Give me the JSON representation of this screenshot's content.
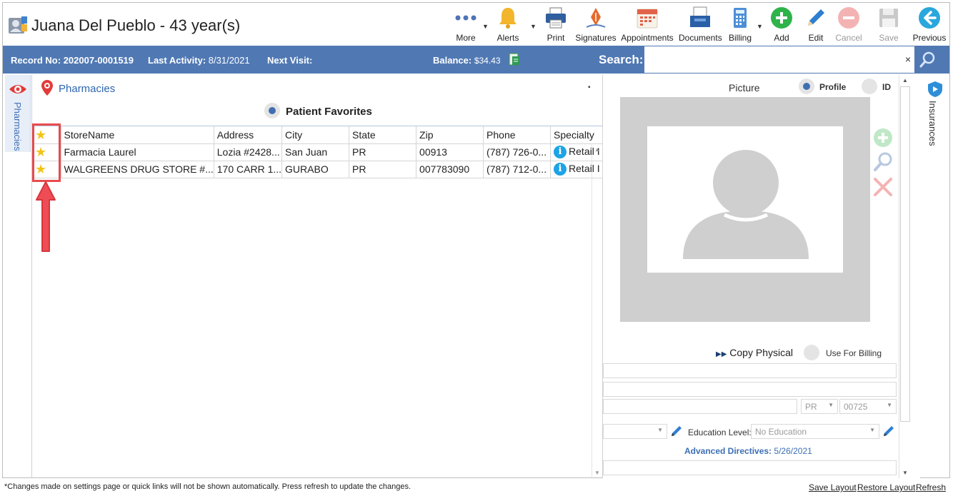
{
  "header": {
    "patient_title": "Juana Del Pueblo - 43 year(s)",
    "toolbar": [
      {
        "key": "more",
        "label": "More",
        "icon": "more-dots-icon",
        "enabled": true
      },
      {
        "key": "alerts",
        "label": "Alerts",
        "icon": "bell-icon",
        "enabled": true
      },
      {
        "key": "print",
        "label": "Print",
        "icon": "printer-icon",
        "enabled": true
      },
      {
        "key": "signatures",
        "label": "Signatures",
        "icon": "pen-nib-icon",
        "enabled": true
      },
      {
        "key": "appointments",
        "label": "Appointments",
        "icon": "calendar-icon",
        "enabled": true
      },
      {
        "key": "documents",
        "label": "Documents",
        "icon": "documents-tray-icon",
        "enabled": true
      },
      {
        "key": "billing",
        "label": "Billing",
        "icon": "calculator-icon",
        "enabled": true
      },
      {
        "key": "add",
        "label": "Add",
        "icon": "plus-circle-icon",
        "enabled": true
      },
      {
        "key": "edit",
        "label": "Edit",
        "icon": "pencil-icon",
        "enabled": true
      },
      {
        "key": "cancel",
        "label": "Cancel",
        "icon": "minus-circle-icon",
        "enabled": false
      },
      {
        "key": "save",
        "label": "Save",
        "icon": "floppy-disk-icon",
        "enabled": false
      },
      {
        "key": "previous",
        "label": "Previous",
        "icon": "arrow-left-circle-icon",
        "enabled": true
      }
    ]
  },
  "infobar": {
    "record_label": "Record No:",
    "record_value": "202007-0001519",
    "last_activity_label": "Last Activity:",
    "last_activity_value": "8/31/2021",
    "next_visit_label": "Next Visit:",
    "balance_label": "Balance:",
    "balance_value": "$34.43",
    "search_label": "Search:",
    "search_value": "",
    "clear_symbol": "×"
  },
  "left_tab": {
    "label": "Pharmacies"
  },
  "right_tab": {
    "label": "Insurances"
  },
  "pharmacies": {
    "title": "Pharmacies",
    "filter_label": "Patient Favorites",
    "columns": [
      "",
      "StoreName",
      "Address",
      "City",
      "State",
      "Zip",
      "Phone",
      "Specialty"
    ],
    "rows": [
      {
        "favorite": "★",
        "store": "Farmacia Laurel",
        "address": "Lozia #2428...",
        "city": "San Juan",
        "state": "PR",
        "zip": "00913",
        "phone": "(787) 726-0...",
        "specialty": "Retail I"
      },
      {
        "favorite": "★",
        "store": "WALGREENS DRUG STORE #...",
        "address": "170 CARR 1...",
        "city": "GURABO",
        "state": "PR",
        "zip": "007783090",
        "phone": "(787) 712-0...",
        "specialty": "Retail I"
      }
    ]
  },
  "picture": {
    "title": "Picture",
    "profile_label": "Profile",
    "id_label": "ID",
    "copy_physical": "Copy Physical",
    "use_for_billing": "Use For Billing",
    "state_value": "PR",
    "zip_value": "00725",
    "education_label": "Education Level:",
    "education_value": "No Education",
    "advanced_directives_label": "Advanced Directives:",
    "advanced_directives_value": "5/26/2021"
  },
  "footer": {
    "note": "*Changes made on settings page or quick links will not be shown automatically. Press refresh to update the changes.",
    "save_layout": "Save Layout",
    "restore_layout": "Restore Layout",
    "refresh": "Refresh"
  },
  "colors": {
    "infobar": "#5079b4",
    "link_blue": "#2e66b0",
    "star": "#f2c418",
    "annotation": "#e84b4f",
    "add_green": "#2fb34a",
    "previous_teal": "#2aa7dc"
  }
}
